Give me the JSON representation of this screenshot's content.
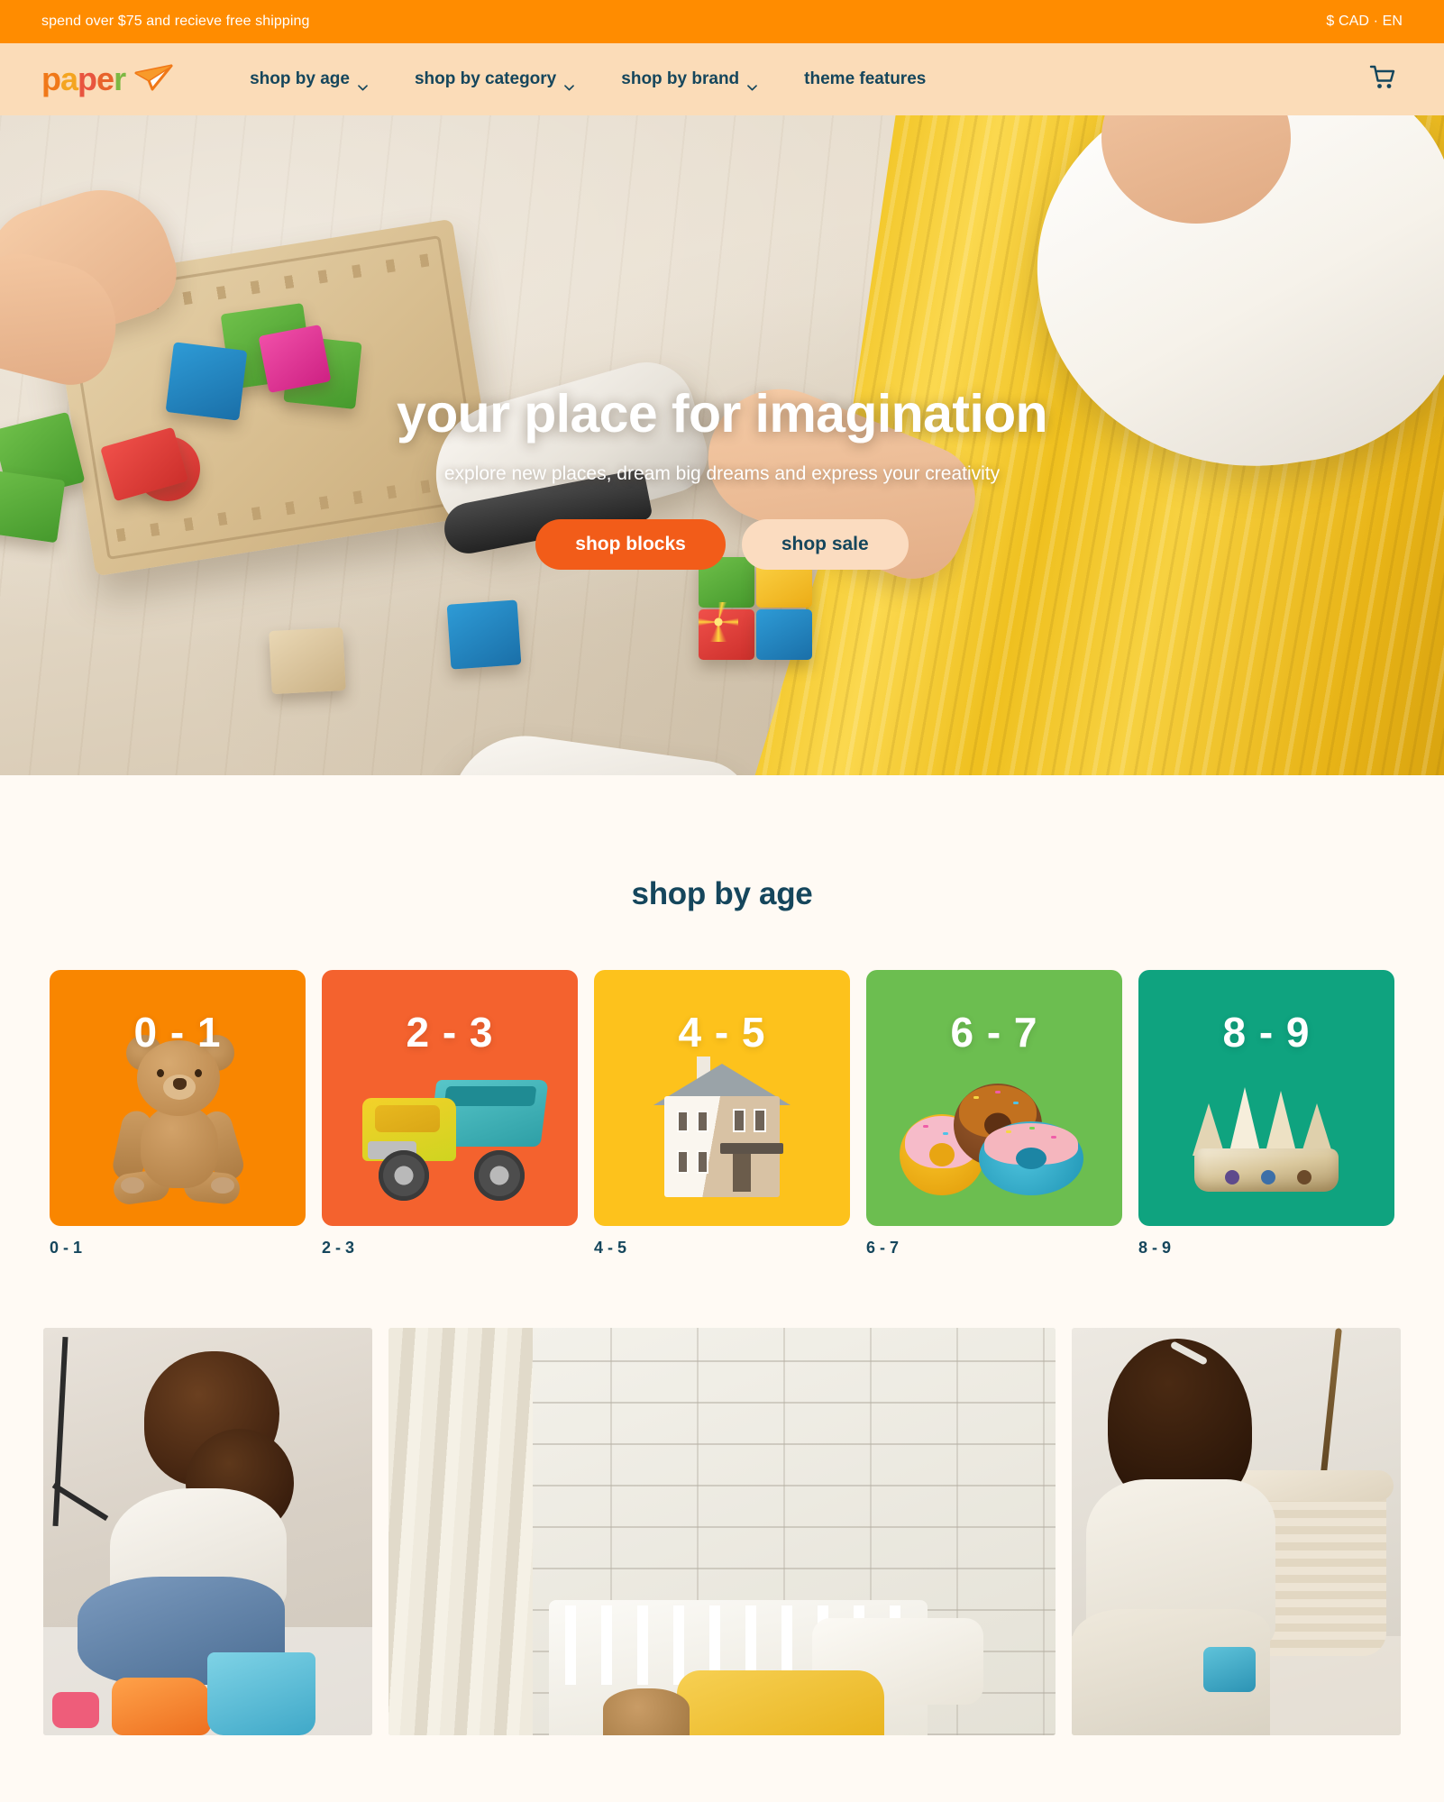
{
  "announcement": {
    "text": "spend over $75 and recieve free shipping",
    "locale": "$ CAD · EN"
  },
  "header": {
    "logo_text": "paper",
    "logo_icon": "paper-plane-icon",
    "cart_icon": "shopping-cart-icon",
    "nav": [
      {
        "label": "shop by age",
        "has_dropdown": true
      },
      {
        "label": "shop by category",
        "has_dropdown": true
      },
      {
        "label": "shop by brand",
        "has_dropdown": true
      },
      {
        "label": "theme features",
        "has_dropdown": false
      }
    ]
  },
  "hero": {
    "title": "your place for imagination",
    "subtitle": "explore new places, dream big dreams and express your creativity",
    "primary_button": "shop blocks",
    "secondary_button": "shop sale"
  },
  "shop_by_age": {
    "title": "shop by age",
    "cards": [
      {
        "range": "0 - 1",
        "label": "0 - 1",
        "color": "#F98600",
        "toy": "teddy-bear"
      },
      {
        "range": "2 - 3",
        "label": "2 - 3",
        "color": "#F4622E",
        "toy": "dump-truck"
      },
      {
        "range": "4 - 5",
        "label": "4 - 5",
        "color": "#FDC21C",
        "toy": "dollhouse"
      },
      {
        "range": "6 - 7",
        "label": "6 - 7",
        "color": "#6CBE50",
        "toy": "donuts"
      },
      {
        "range": "8 - 9",
        "label": "8 - 9",
        "color": "#0FA37F",
        "toy": "crown"
      }
    ]
  },
  "photo_gallery": {
    "tiles": [
      {
        "alt": "girl playing with toys on a rug"
      },
      {
        "alt": "childrens bedroom with white brick wall"
      },
      {
        "alt": "girl kneeling beside a woven storage basket"
      }
    ]
  },
  "colors": {
    "announcement_bg": "#FF8C00",
    "header_bg": "#FBDCB8",
    "page_bg": "#FFFAF4",
    "text_navy": "#15465C",
    "accent_orange": "#F25C19",
    "button_peach": "#FBDCC0"
  }
}
